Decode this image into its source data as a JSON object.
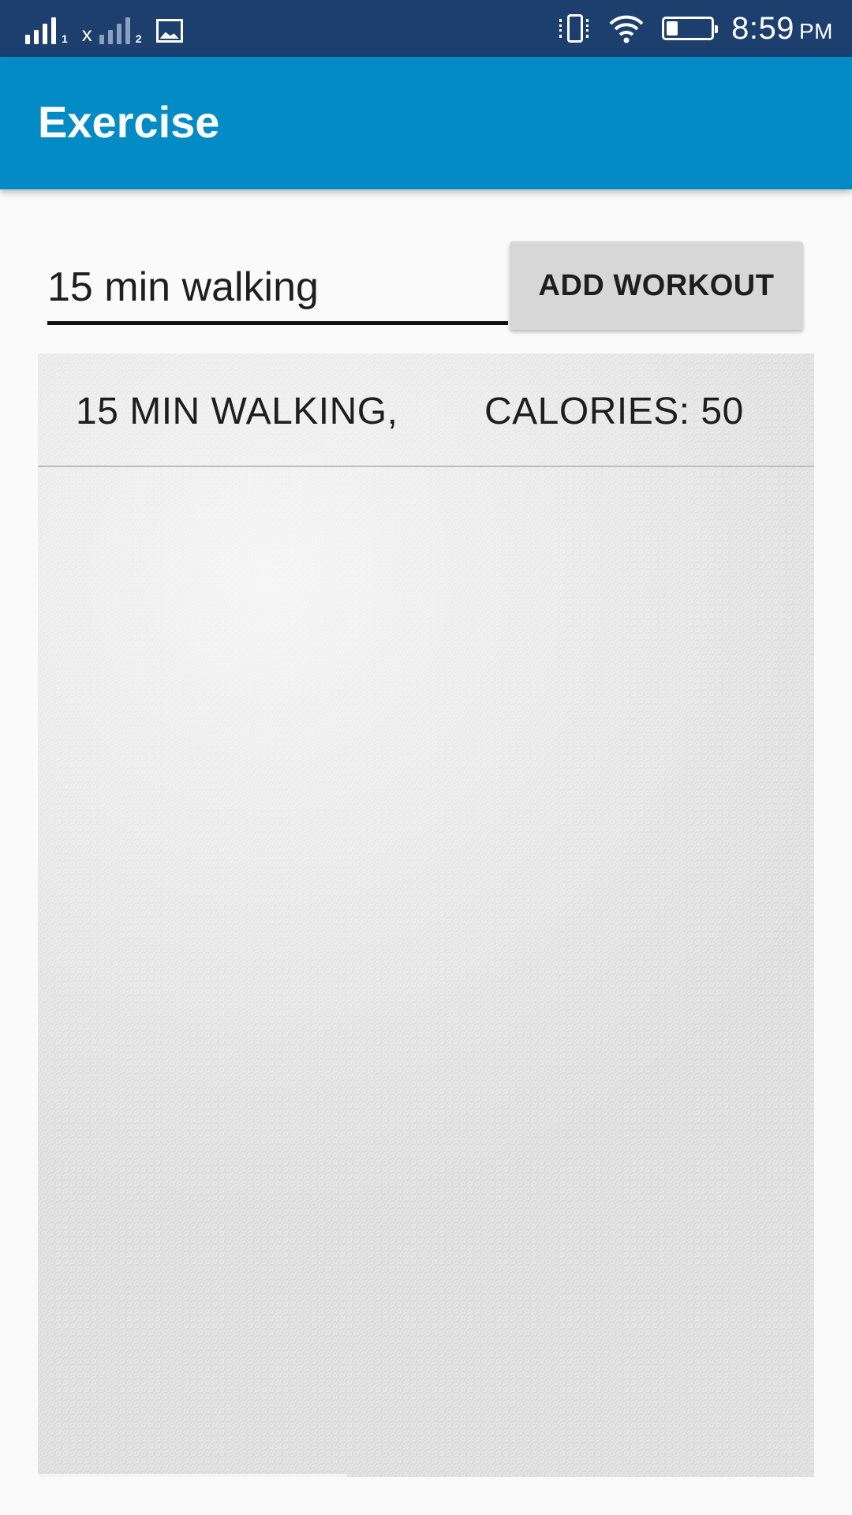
{
  "status_bar": {
    "sim1_label": "1",
    "sim2_label": "2",
    "sim2_prefix": "x",
    "time": "8:59",
    "ampm": "PM",
    "battery_level": 0.25,
    "icons": [
      "signal-icon",
      "signal-no-data-icon",
      "image-notification-icon",
      "vibrate-icon",
      "wifi-icon",
      "battery-icon"
    ]
  },
  "app_bar": {
    "title": "Exercise"
  },
  "form": {
    "input_value": "15 min walking",
    "add_button_label": "ADD WORKOUT"
  },
  "workouts": {
    "items": [
      {
        "name": "15 MIN WALKING,",
        "calories": "CALORIES: 50"
      }
    ]
  },
  "colors": {
    "status_bar": "#1c3f6e",
    "app_bar": "#028bc5",
    "button": "#d7d7d7",
    "background": "#fafafa"
  }
}
